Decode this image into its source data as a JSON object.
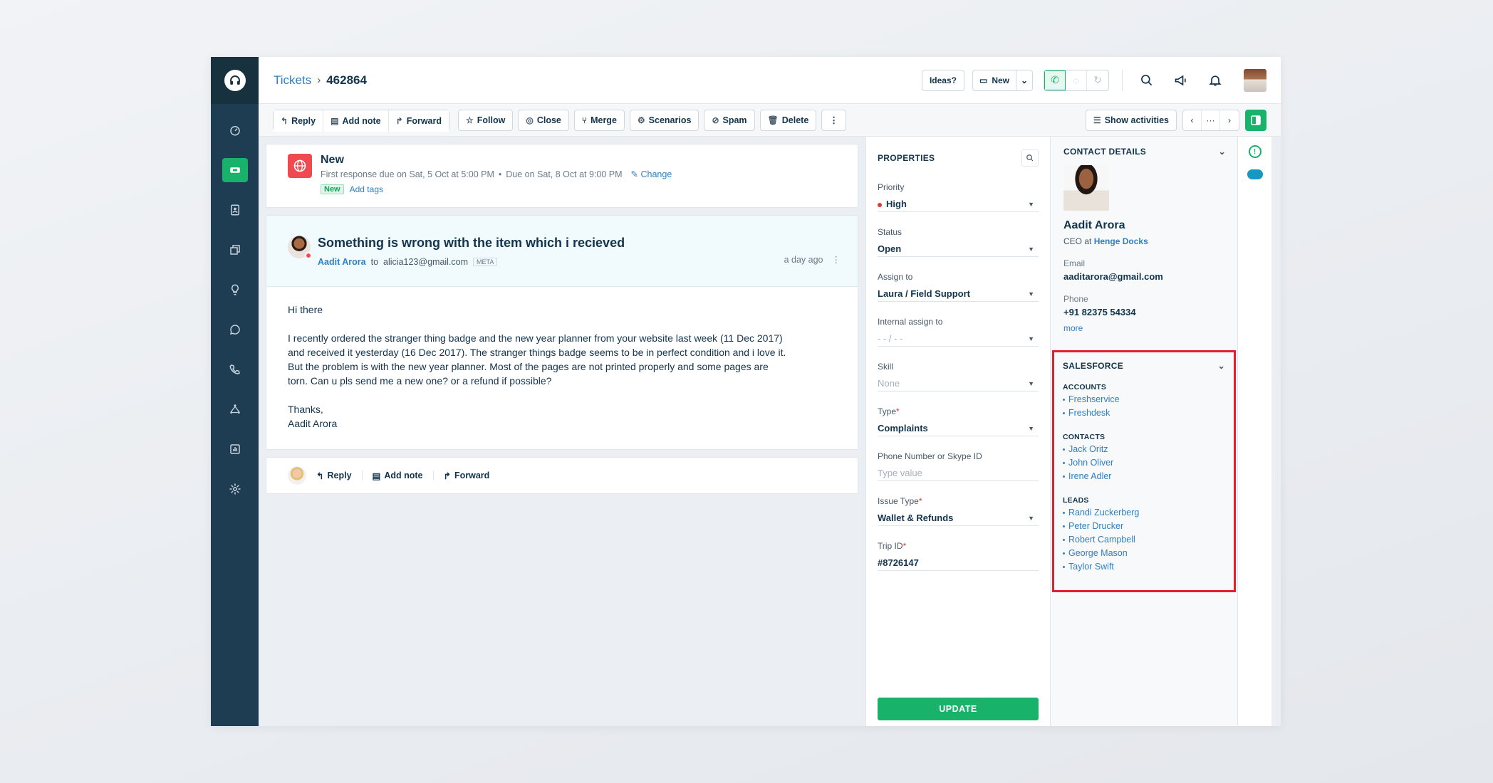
{
  "breadcrumb": {
    "root": "Tickets",
    "separator": "›",
    "ticket_id": "462864"
  },
  "topbar": {
    "ideas_label": "Ideas?",
    "new_label": "New"
  },
  "toolbar": {
    "reply": "Reply",
    "add_note": "Add note",
    "forward": "Forward",
    "follow": "Follow",
    "close": "Close",
    "merge": "Merge",
    "scenarios": "Scenarios",
    "spam": "Spam",
    "delete": "Delete",
    "more": "⋮",
    "show_activities": "Show activities",
    "nav_more": "···"
  },
  "status": {
    "title": "New",
    "first_response": "First response due on Sat, 5 Oct at 5:00 PM",
    "bullet": "•",
    "due": "Due on Sat, 8 Oct at 9:00 PM",
    "change": "Change",
    "tag": "New",
    "add_tags": "Add tags"
  },
  "message": {
    "subject": "Something is wrong with the item which i recieved",
    "from": "Aadit Arora",
    "to_word": "to",
    "to": "alicia123@gmail.com",
    "meta": "META",
    "time": "a day ago",
    "greeting": "Hi there",
    "body": "I recently ordered the stranger thing badge and the new year planner from your website last week (11 Dec 2017)\nand received it yesterday (16 Dec 2017). The stranger things badge seems to be in perfect condition and i love it.\nBut the problem is with the new year planner. Most of the pages are not printed properly and some pages are\ntorn. Can u pls send me a new one? or a refund if possible?",
    "signoff": "Thanks,\nAadit Arora"
  },
  "reply_bar": {
    "reply": "Reply",
    "add_note": "Add note",
    "forward": "Forward"
  },
  "properties": {
    "heading": "PROPERTIES",
    "priority_label": "Priority",
    "priority_value": "High",
    "status_label": "Status",
    "status_value": "Open",
    "assign_label": "Assign to",
    "assign_value": "Laura / Field Support",
    "internal_label": "Internal assign to",
    "internal_value": "- - / - -",
    "skill_label": "Skill",
    "skill_value": "None",
    "type_label": "Type",
    "type_value": "Complaints",
    "phone_label": "Phone Number or Skype ID",
    "phone_placeholder": "Type value",
    "issue_label": "Issue Type",
    "issue_value": "Wallet & Refunds",
    "trip_label": "Trip ID",
    "trip_value": "#8726147",
    "required_mark": "*",
    "update": "UPDATE"
  },
  "contact": {
    "heading": "CONTACT DETAILS",
    "name": "Aadit Arora",
    "role": "CEO",
    "at": "at",
    "company": "Henge Docks",
    "email_label": "Email",
    "email": "aaditarora@gmail.com",
    "phone_label": "Phone",
    "phone": "+91 82375 54334",
    "more": "more"
  },
  "salesforce": {
    "heading": "SALESFORCE",
    "accounts_label": "ACCOUNTS",
    "accounts": [
      "Freshservice",
      "Freshdesk"
    ],
    "contacts_label": "CONTACTS",
    "contacts": [
      "Jack Oritz",
      "John Oliver",
      "Irene Adler"
    ],
    "leads_label": "LEADS",
    "leads": [
      "Randi Zuckerberg",
      "Peter Drucker",
      "Robert Campbell",
      "George Mason",
      "Taylor Swift"
    ]
  },
  "colors": {
    "accent_green": "#18b26b",
    "link_blue": "#2f7fc2",
    "rail": "#1f3d52",
    "highlight_red": "#e0202a"
  }
}
